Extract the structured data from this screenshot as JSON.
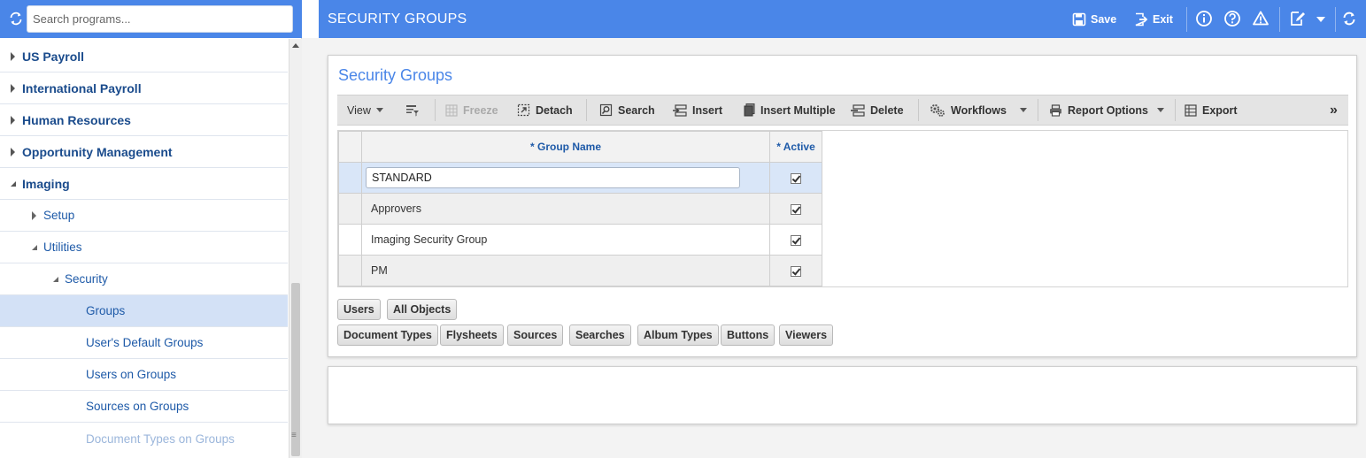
{
  "sidebar": {
    "search_placeholder": "Search programs...",
    "items": [
      {
        "label": "US Payroll",
        "level": 0,
        "expanded": false
      },
      {
        "label": "International Payroll",
        "level": 0,
        "expanded": false
      },
      {
        "label": "Human Resources",
        "level": 0,
        "expanded": false
      },
      {
        "label": "Opportunity Management",
        "level": 0,
        "expanded": false
      },
      {
        "label": "Imaging",
        "level": 0,
        "expanded": true
      },
      {
        "label": "Setup",
        "level": 1,
        "expanded": false
      },
      {
        "label": "Utilities",
        "level": 1,
        "expanded": true
      },
      {
        "label": "Security",
        "level": 2,
        "expanded": true
      },
      {
        "label": "Groups",
        "level": 3,
        "selected": true
      },
      {
        "label": "User's Default Groups",
        "level": 3
      },
      {
        "label": "Users on Groups",
        "level": 3
      },
      {
        "label": "Sources on Groups",
        "level": 3
      },
      {
        "label": "Document Types on Groups",
        "level": 3,
        "faded": true
      }
    ]
  },
  "header": {
    "title": "SECURITY GROUPS",
    "save_label": "Save",
    "exit_label": "Exit",
    "icons": [
      "info-icon",
      "help-icon",
      "warning-icon",
      "edit-note-icon",
      "chevron-down-icon",
      "refresh-icon"
    ]
  },
  "panel": {
    "title": "Security Groups",
    "toolbar": {
      "view": "View",
      "freeze": "Freeze",
      "detach": "Detach",
      "search": "Search",
      "insert": "Insert",
      "insert_multiple": "Insert Multiple",
      "delete": "Delete",
      "workflows": "Workflows",
      "report_options": "Report Options",
      "export": "Export",
      "more": "»"
    },
    "grid": {
      "columns": [
        "* Group Name",
        "* Active"
      ],
      "rows": [
        {
          "group_name": "STANDARD",
          "active": true,
          "editing": true
        },
        {
          "group_name": "Approvers",
          "active": true
        },
        {
          "group_name": "Imaging Security Group",
          "active": true
        },
        {
          "group_name": "PM",
          "active": true
        }
      ]
    },
    "detail_buttons_row1": [
      "Users",
      "All Objects"
    ],
    "detail_buttons_row2": [
      "Document Types",
      "Flysheets",
      "Sources",
      "Searches",
      "Album Types",
      "Buttons",
      "Viewers"
    ]
  },
  "colors": {
    "accent": "#4a86e8",
    "selected_row": "#d3e1f6",
    "link": "#1e5aa8"
  }
}
